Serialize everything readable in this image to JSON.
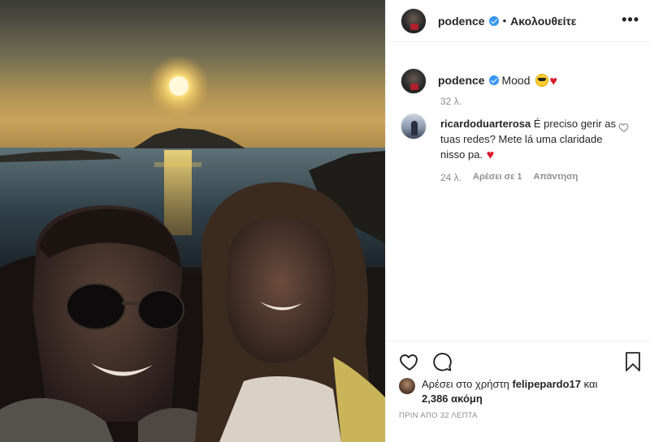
{
  "header": {
    "username": "podence",
    "separator": "•",
    "follow_state": "Ακολουθείτε",
    "more_glyph": "•••",
    "avatar_icon": "user-avatar-icon"
  },
  "caption": {
    "username": "podence",
    "text": "Mood",
    "emojis": [
      "sunglasses-emoji-icon",
      "red-heart-emoji-icon"
    ],
    "time": "32 λ."
  },
  "comments": [
    {
      "username": "ricardoduarterosa",
      "text": "É preciso gerir as tuas redes? Mete lá uma claridade nisso pa.",
      "time": "24 λ.",
      "likes_label": "Αρέσει σε 1",
      "reply_label": "Απάντηση"
    }
  ],
  "actions": {
    "icons": [
      "heart-icon",
      "comment-icon",
      "bookmark-icon"
    ]
  },
  "likes": {
    "prefix": "Αρέσει στο χρήστη",
    "user": "felipepardo17",
    "and": "και",
    "others": "2,386 ακόμη"
  },
  "post_time": "ΠΡΙΝ ΑΠΟ 32 ΛΕΠΤΑ",
  "colors": {
    "verified": "#3897f0",
    "heart": "#d91a2a",
    "muted": "#8e8e8e",
    "text": "#262626",
    "border": "#efefef"
  }
}
